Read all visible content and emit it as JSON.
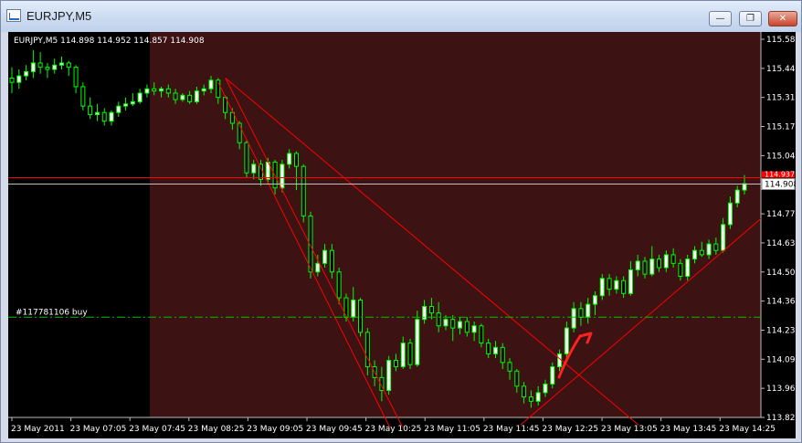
{
  "window": {
    "title": "EURJPY,M5",
    "minimize_symbol": "—",
    "restore_symbol": "❐",
    "close_symbol": "✕"
  },
  "chart_header": "EURJPY,M5  114.898 114.952 114.857 114.908",
  "order_label": "#117781106 buy",
  "price_label": "114.908",
  "price_label_partial": "114.937",
  "price_axis": [
    "115.580",
    "115.445",
    "115.310",
    "115.175",
    "115.040",
    "114.905",
    "114.770",
    "114.635",
    "114.500",
    "114.365",
    "114.230",
    "114.095",
    "113.960",
    "113.825"
  ],
  "time_axis": [
    "23 May 2011",
    "23 May 07:05",
    "23 May 07:45",
    "23 May 08:25",
    "23 May 09:05",
    "23 May 09:45",
    "23 May 10:25",
    "23 May 11:05",
    "23 May 11:45",
    "23 May 12:25",
    "23 May 13:05",
    "23 May 13:45",
    "23 May 14:25"
  ],
  "colors": {
    "background": "#000000",
    "session_shade": "#3c1212",
    "bull_candle": "#ffffff",
    "candle_outline": "#00ff00",
    "trendline": "#ff0000",
    "order_line": "#00c000",
    "arrow": "#ff2020",
    "axis_text": "#ffffff"
  },
  "icons": [
    "chart-window-icon",
    "minimize-icon",
    "restore-icon",
    "close-icon",
    "arrow-annotation"
  ],
  "chart_data": {
    "type": "candlestick",
    "symbol": "EURJPY",
    "timeframe": "M5",
    "ohlc_header": {
      "open": 114.898,
      "high": 114.952,
      "low": 114.857,
      "close": 114.908
    },
    "ylim": [
      113.825,
      115.58
    ],
    "y_ticks": [
      115.58,
      115.445,
      115.31,
      115.175,
      115.04,
      114.905,
      114.77,
      114.635,
      114.5,
      114.365,
      114.23,
      114.095,
      113.96,
      113.825
    ],
    "bid_line": 114.908,
    "order_line": 114.29,
    "candles": [
      [
        115.4,
        115.38,
        115.45,
        115.33
      ],
      [
        115.38,
        115.41,
        115.44,
        115.35
      ],
      [
        115.41,
        115.43,
        115.46,
        115.39
      ],
      [
        115.43,
        115.47,
        115.53,
        115.4
      ],
      [
        115.47,
        115.45,
        115.52,
        115.42
      ],
      [
        115.45,
        115.44,
        115.47,
        115.4
      ],
      [
        115.44,
        115.46,
        115.49,
        115.42
      ],
      [
        115.46,
        115.47,
        115.5,
        115.44
      ],
      [
        115.47,
        115.45,
        115.48,
        115.41
      ],
      [
        115.45,
        115.36,
        115.46,
        115.33
      ],
      [
        115.36,
        115.27,
        115.38,
        115.25
      ],
      [
        115.27,
        115.23,
        115.31,
        115.21
      ],
      [
        115.23,
        115.24,
        115.28,
        115.2
      ],
      [
        115.24,
        115.2,
        115.26,
        115.18
      ],
      [
        115.2,
        115.24,
        115.25,
        115.18
      ],
      [
        115.24,
        115.27,
        115.29,
        115.22
      ],
      [
        115.27,
        115.28,
        115.31,
        115.25
      ],
      [
        115.28,
        115.29,
        115.33,
        115.27
      ],
      [
        115.29,
        115.33,
        115.35,
        115.28
      ],
      [
        115.33,
        115.35,
        115.37,
        115.31
      ],
      [
        115.35,
        115.34,
        115.38,
        115.32
      ],
      [
        115.34,
        115.35,
        115.36,
        115.31
      ],
      [
        115.35,
        115.33,
        115.37,
        115.31
      ],
      [
        115.33,
        115.3,
        115.35,
        115.28
      ],
      [
        115.3,
        115.32,
        115.33,
        115.29
      ],
      [
        115.32,
        115.29,
        115.34,
        115.28
      ],
      [
        115.29,
        115.34,
        115.36,
        115.28
      ],
      [
        115.34,
        115.35,
        115.37,
        115.32
      ],
      [
        115.35,
        115.39,
        115.41,
        115.33
      ],
      [
        115.39,
        115.31,
        115.4,
        115.28
      ],
      [
        115.31,
        115.24,
        115.32,
        115.21
      ],
      [
        115.24,
        115.19,
        115.26,
        115.16
      ],
      [
        115.19,
        115.1,
        115.2,
        115.07
      ],
      [
        115.1,
        114.96,
        115.11,
        114.94
      ],
      [
        114.96,
        115.0,
        115.02,
        114.93
      ],
      [
        115.0,
        114.93,
        115.02,
        114.9
      ],
      [
        114.93,
        115.01,
        115.03,
        114.91
      ],
      [
        115.01,
        114.89,
        115.02,
        114.86
      ],
      [
        114.89,
        115.0,
        115.02,
        114.87
      ],
      [
        115.0,
        115.05,
        115.07,
        114.98
      ],
      [
        115.05,
        114.99,
        115.06,
        114.88
      ],
      [
        114.99,
        114.76,
        115.0,
        114.73
      ],
      [
        114.76,
        114.5,
        114.78,
        114.47
      ],
      [
        114.5,
        114.54,
        114.58,
        114.48
      ],
      [
        114.54,
        114.6,
        114.63,
        114.52
      ],
      [
        114.6,
        114.5,
        114.63,
        114.47
      ],
      [
        114.5,
        114.38,
        114.52,
        114.35
      ],
      [
        114.38,
        114.29,
        114.4,
        114.27
      ],
      [
        114.29,
        114.37,
        114.43,
        114.27
      ],
      [
        114.37,
        114.22,
        114.38,
        114.2
      ],
      [
        114.22,
        114.06,
        114.24,
        114.02
      ],
      [
        114.06,
        114.01,
        114.09,
        113.97
      ],
      [
        114.01,
        113.95,
        114.06,
        113.9
      ],
      [
        113.95,
        114.09,
        114.11,
        113.93
      ],
      [
        114.09,
        114.06,
        114.12,
        114.04
      ],
      [
        114.06,
        114.17,
        114.2,
        114.05
      ],
      [
        114.17,
        114.07,
        114.19,
        114.05
      ],
      [
        114.07,
        114.28,
        114.32,
        114.06
      ],
      [
        114.28,
        114.34,
        114.37,
        114.26
      ],
      [
        114.34,
        114.31,
        114.38,
        114.28
      ],
      [
        114.31,
        114.25,
        114.36,
        114.22
      ],
      [
        114.25,
        114.28,
        114.3,
        114.23
      ],
      [
        114.28,
        114.24,
        114.3,
        114.18
      ],
      [
        114.24,
        114.27,
        114.29,
        114.21
      ],
      [
        114.27,
        114.22,
        114.29,
        114.2
      ],
      [
        114.22,
        114.25,
        114.27,
        114.18
      ],
      [
        114.25,
        114.17,
        114.26,
        114.15
      ],
      [
        114.17,
        114.12,
        114.19,
        114.1
      ],
      [
        114.12,
        114.15,
        114.18,
        114.1
      ],
      [
        114.15,
        114.08,
        114.17,
        114.05
      ],
      [
        114.08,
        114.04,
        114.1,
        114.0
      ],
      [
        114.04,
        113.97,
        114.05,
        113.94
      ],
      [
        113.97,
        113.92,
        113.99,
        113.89
      ],
      [
        113.92,
        113.9,
        113.95,
        113.87
      ],
      [
        113.9,
        113.94,
        113.97,
        113.88
      ],
      [
        113.94,
        113.98,
        114.0,
        113.92
      ],
      [
        113.98,
        114.06,
        114.08,
        113.96
      ],
      [
        114.06,
        114.12,
        114.14,
        114.04
      ],
      [
        114.12,
        114.24,
        114.27,
        114.1
      ],
      [
        114.24,
        114.33,
        114.36,
        114.22
      ],
      [
        114.33,
        114.29,
        114.36,
        114.25
      ],
      [
        114.29,
        114.35,
        114.38,
        114.26
      ],
      [
        114.35,
        114.39,
        114.41,
        114.3
      ],
      [
        114.39,
        114.47,
        114.49,
        114.37
      ],
      [
        114.47,
        114.42,
        114.49,
        114.39
      ],
      [
        114.42,
        114.46,
        114.48,
        114.4
      ],
      [
        114.46,
        114.4,
        114.48,
        114.38
      ],
      [
        114.4,
        114.51,
        114.55,
        114.39
      ],
      [
        114.51,
        114.55,
        114.58,
        114.48
      ],
      [
        114.55,
        114.49,
        114.57,
        114.47
      ],
      [
        114.49,
        114.56,
        114.62,
        114.48
      ],
      [
        114.56,
        114.52,
        114.58,
        114.5
      ],
      [
        114.52,
        114.58,
        114.6,
        114.5
      ],
      [
        114.58,
        114.54,
        114.61,
        114.52
      ],
      [
        114.54,
        114.48,
        114.56,
        114.46
      ],
      [
        114.48,
        114.56,
        114.58,
        114.46
      ],
      [
        114.56,
        114.6,
        114.62,
        114.54
      ],
      [
        114.6,
        114.58,
        114.64,
        114.57
      ],
      [
        114.58,
        114.63,
        114.65,
        114.56
      ],
      [
        114.63,
        114.6,
        114.66,
        114.58
      ],
      [
        114.6,
        114.72,
        114.75,
        114.59
      ],
      [
        114.72,
        114.82,
        114.85,
        114.7
      ],
      [
        114.82,
        114.88,
        114.9,
        114.8
      ],
      [
        114.88,
        114.91,
        114.95,
        114.86
      ]
    ],
    "trendlines": [
      {
        "from": [
          "23 May 08:25",
          115.4
        ],
        "to": [
          "23 May 10:25",
          113.78
        ]
      },
      {
        "from": [
          "23 May 08:25",
          115.4
        ],
        "to": [
          "23 May 13:05",
          113.79
        ]
      },
      {
        "from": [
          "23 May 11:45",
          113.79
        ],
        "to": [
          "23 May 14:25",
          114.73
        ]
      }
    ]
  }
}
